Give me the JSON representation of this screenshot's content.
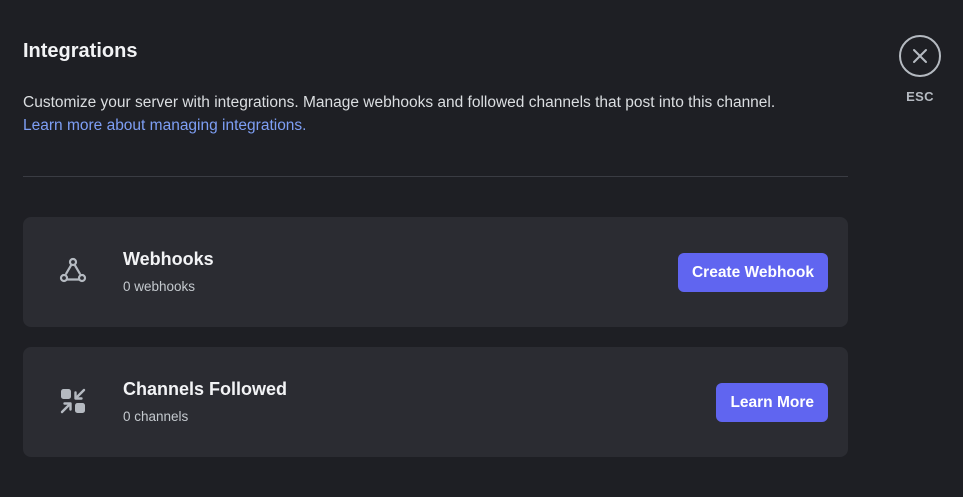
{
  "header": {
    "title": "Integrations",
    "description": "Customize your server with integrations. Manage webhooks and followed channels that post into this channel.",
    "learn_more_link": "Learn more about managing integrations."
  },
  "close": {
    "icon": "close-icon",
    "label": "ESC"
  },
  "cards": [
    {
      "icon": "webhook-icon",
      "name": "Webhooks",
      "count": "0 webhooks",
      "button_label": "Create Webhook"
    },
    {
      "icon": "channels-followed-icon",
      "name": "Channels Followed",
      "count": "0 channels",
      "button_label": "Learn More"
    }
  ],
  "colors": {
    "background": "#1e1f24",
    "card": "#2b2c32",
    "accent_button": "#6065f0",
    "link": "#7e9ff5"
  }
}
